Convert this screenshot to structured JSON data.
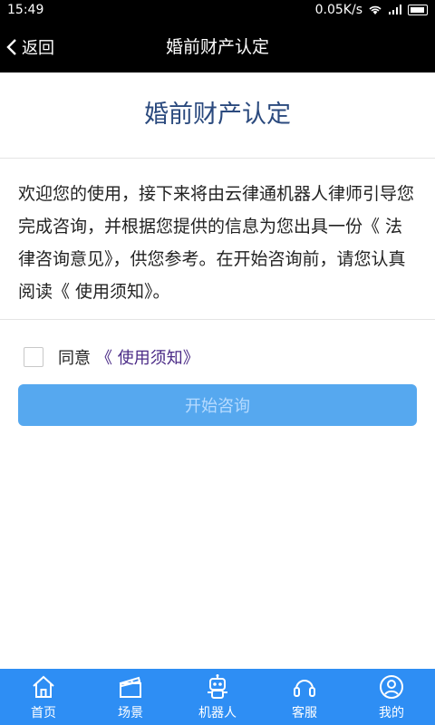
{
  "status": {
    "time": "15:49",
    "speed": "0.05K/s"
  },
  "nav": {
    "back_label": "返回",
    "title": "婚前财产认定"
  },
  "content": {
    "heading": "婚前财产认定",
    "intro": "欢迎您的使用，接下来将由云律通机器人律师引导您完成咨询，并根据您提供的信息为您出具一份《 法律咨询意见》，供您参考。在开始咨询前，请您认真阅读《 使用须知》。"
  },
  "agreement": {
    "label": "同意",
    "link_text": "《 使用须知》"
  },
  "start_button": {
    "label": "开始咨询"
  },
  "tabs": [
    {
      "label": "首页",
      "icon": "home-icon"
    },
    {
      "label": "场景",
      "icon": "clapperboard-icon"
    },
    {
      "label": "机器人",
      "icon": "robot-icon"
    },
    {
      "label": "客服",
      "icon": "headset-icon"
    },
    {
      "label": "我的",
      "icon": "user-icon"
    }
  ],
  "colors": {
    "accent": "#2e8ef4",
    "title_blue": "#2b4a7e",
    "link_purple": "#4a2a86"
  }
}
